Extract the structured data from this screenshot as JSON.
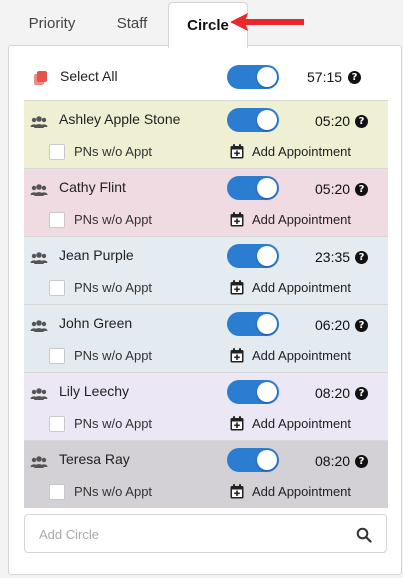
{
  "tabs": [
    {
      "label": "Priority",
      "active": false
    },
    {
      "label": "Staff",
      "active": false
    },
    {
      "label": "Circle",
      "active": true
    }
  ],
  "colors": {
    "accent": "#2a7dd1",
    "arrow": "#e8282a",
    "copy_icon": "#e5534b"
  },
  "select_all": {
    "label": "Select All",
    "toggle_on": true,
    "time": "57:15",
    "icon": "copy-icon"
  },
  "circles": [
    {
      "name": "Ashley Apple Stone",
      "time": "05:20",
      "toggle_on": true,
      "pn_label": "PNs w/o Appt",
      "add_label": "Add Appointment",
      "bg": "#eff0d3"
    },
    {
      "name": "Cathy Flint",
      "time": "05:20",
      "toggle_on": true,
      "pn_label": "PNs w/o Appt",
      "add_label": "Add Appointment",
      "bg": "#f1dbe3"
    },
    {
      "name": "Jean Purple",
      "time": "23:35",
      "toggle_on": true,
      "pn_label": "PNs w/o Appt",
      "add_label": "Add Appointment",
      "bg": "#e4ebf1"
    },
    {
      "name": "John Green",
      "time": "06:20",
      "toggle_on": true,
      "pn_label": "PNs w/o Appt",
      "add_label": "Add Appointment",
      "bg": "#e3ebf0"
    },
    {
      "name": "Lily Leechy",
      "time": "08:20",
      "toggle_on": true,
      "pn_label": "PNs w/o Appt",
      "add_label": "Add Appointment",
      "bg": "#ebe7f5"
    },
    {
      "name": "Teresa Ray",
      "time": "08:20",
      "toggle_on": true,
      "pn_label": "PNs w/o Appt",
      "add_label": "Add Appointment",
      "bg": "#d3d0d6"
    }
  ],
  "search": {
    "placeholder": "Add Circle",
    "value": ""
  }
}
